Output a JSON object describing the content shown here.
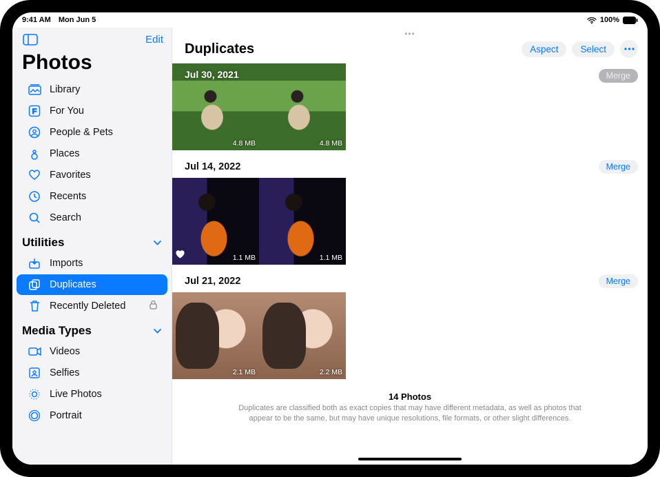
{
  "status": {
    "time": "9:41 AM",
    "date": "Mon Jun 5",
    "battery": "100%"
  },
  "sidebar": {
    "edit": "Edit",
    "title": "Photos",
    "items": [
      {
        "label": "Library"
      },
      {
        "label": "For You"
      },
      {
        "label": "People & Pets"
      },
      {
        "label": "Places"
      },
      {
        "label": "Favorites"
      },
      {
        "label": "Recents"
      },
      {
        "label": "Search"
      }
    ],
    "utilities_head": "Utilities",
    "utilities": [
      {
        "label": "Imports"
      },
      {
        "label": "Duplicates"
      },
      {
        "label": "Recently Deleted"
      }
    ],
    "media_head": "Media Types",
    "media": [
      {
        "label": "Videos"
      },
      {
        "label": "Selfies"
      },
      {
        "label": "Live Photos"
      },
      {
        "label": "Portrait"
      }
    ]
  },
  "main": {
    "title": "Duplicates",
    "aspect": "Aspect",
    "select": "Select",
    "groups": [
      {
        "date": "Jul 30, 2021",
        "merge": "Merge",
        "thumbs": [
          {
            "size": "4.8 MB"
          },
          {
            "size": "4.8 MB"
          }
        ]
      },
      {
        "date": "Jul 14, 2022",
        "merge": "Merge",
        "thumbs": [
          {
            "size": "1.1 MB",
            "fav": true
          },
          {
            "size": "1.1 MB"
          }
        ]
      },
      {
        "date": "Jul 21, 2022",
        "merge": "Merge",
        "thumbs": [
          {
            "size": "2.1 MB"
          },
          {
            "size": "2.2 MB"
          }
        ]
      }
    ],
    "footer_title": "14 Photos",
    "footer_desc": "Duplicates are classified both as exact copies that may have different metadata, as well as photos that appear to be the same, but may have unique resolutions, file formats, or other slight differences."
  }
}
